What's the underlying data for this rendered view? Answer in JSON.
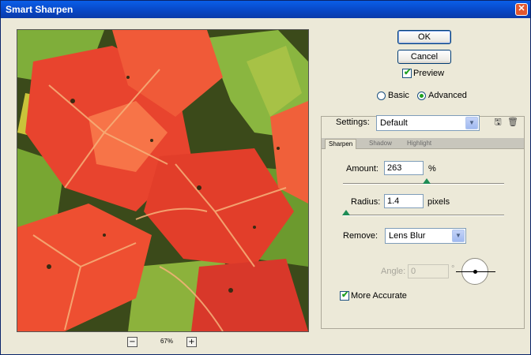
{
  "window": {
    "title": "Smart Sharpen",
    "close_glyph": "✕"
  },
  "preview": {
    "zoom_out_glyph": "−",
    "zoom_in_glyph": "+",
    "zoom_level": "67%"
  },
  "buttons": {
    "ok": "OK",
    "cancel": "Cancel"
  },
  "preview_toggle": {
    "label": "Preview",
    "checked": true
  },
  "mode": {
    "basic": "Basic",
    "advanced": "Advanced",
    "selected": "Advanced"
  },
  "settings": {
    "label": "Settings:",
    "value": "Default"
  },
  "tabs": [
    {
      "label": "Sharpen",
      "active": true
    },
    {
      "label": "Shadow",
      "active": false
    },
    {
      "label": "Highlight",
      "active": false
    }
  ],
  "amount": {
    "label": "Amount:",
    "value": "263",
    "unit": "%",
    "slider_fraction": 0.52
  },
  "radius": {
    "label": "Radius:",
    "value": "1.4",
    "unit": "pixels",
    "slider_fraction": 0.02
  },
  "remove": {
    "label": "Remove:",
    "value": "Lens Blur"
  },
  "angle": {
    "label": "Angle:",
    "value": "0",
    "unit": "°"
  },
  "more_accurate": {
    "label": "More Accurate",
    "checked": true
  },
  "icons": {
    "save_settings": "save-settings-icon",
    "delete_settings": "trash-icon",
    "dropdown_arrow": "chevron-down-icon"
  },
  "colors": {
    "titlebar": "#0a4fd6",
    "accent_check": "#21a121",
    "slider_thumb": "#1e8c55"
  }
}
